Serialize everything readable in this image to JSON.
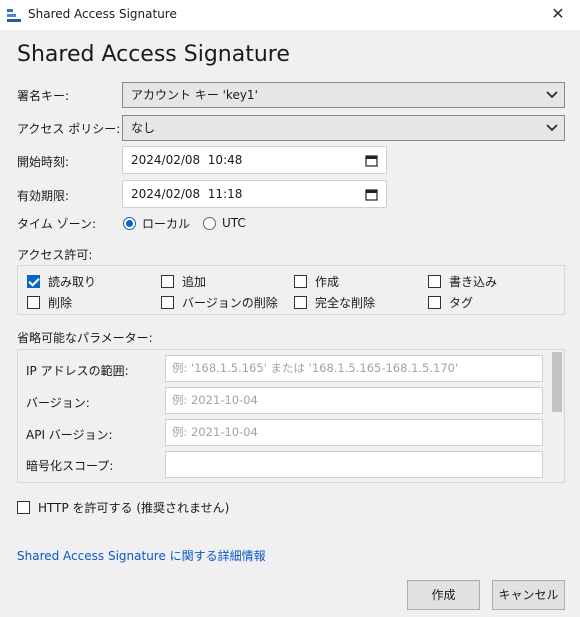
{
  "window": {
    "title": "Shared Access Signature",
    "close_glyph": "✕"
  },
  "page": {
    "heading": "Shared Access Signature"
  },
  "form": {
    "signing_key": {
      "label": "署名キー:",
      "value": "アカウント キー 'key1'"
    },
    "access_policy": {
      "label": "アクセス ポリシー:",
      "value": "なし"
    },
    "start_time": {
      "label": "開始時刻:",
      "value": "2024/02/08  10:48"
    },
    "expiry_time": {
      "label": "有効期限:",
      "value": "2024/02/08  11:18"
    },
    "time_zone": {
      "label": "タイム ゾーン:",
      "local": "ローカル",
      "utc": "UTC",
      "selected": "local"
    }
  },
  "permissions": {
    "label": "アクセス許可:",
    "items": [
      {
        "label": "読み取り",
        "checked": true
      },
      {
        "label": "追加",
        "checked": false
      },
      {
        "label": "作成",
        "checked": false
      },
      {
        "label": "書き込み",
        "checked": false
      },
      {
        "label": "削除",
        "checked": false
      },
      {
        "label": "バージョンの削除",
        "checked": false
      },
      {
        "label": "完全な削除",
        "checked": false
      },
      {
        "label": "タグ",
        "checked": false
      }
    ]
  },
  "optional": {
    "label": "省略可能なパラメーター:",
    "ip_range": {
      "label": "IP アドレスの範囲:",
      "placeholder": "例: '168.1.5.165' または '168.1.5.165-168.1.5.170'"
    },
    "version": {
      "label": "バージョン:",
      "placeholder": "例: 2021-10-04"
    },
    "api_version": {
      "label": "API バージョン:",
      "placeholder": "例: 2021-10-04"
    },
    "encryption_scope": {
      "label": "暗号化スコープ:",
      "placeholder": ""
    }
  },
  "allow_http": {
    "label": "HTTP を許可する (推奨されません)",
    "checked": false
  },
  "link": "Shared Access Signature に関する詳細情報",
  "buttons": {
    "create": "作成",
    "cancel": "キャンセル"
  },
  "colors": {
    "accent": "#0a66c2",
    "link": "#0a58ca",
    "background": "#f0f0f0"
  }
}
